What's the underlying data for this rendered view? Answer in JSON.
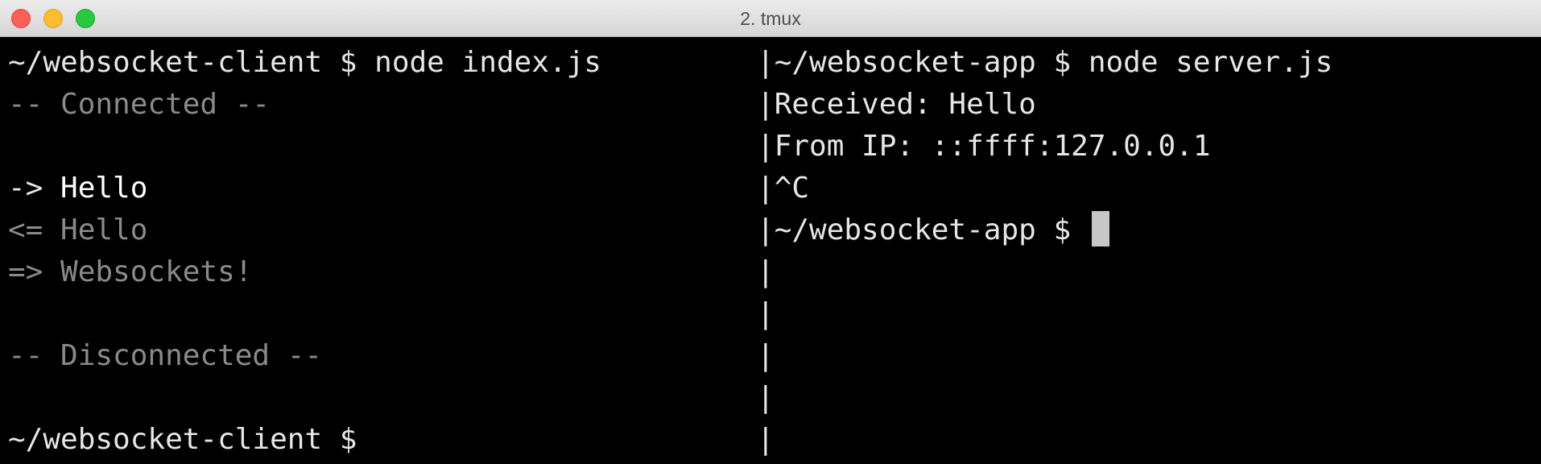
{
  "window": {
    "title": "2. tmux"
  },
  "left_pane": {
    "lines": [
      {
        "prefix": "~/websocket-client $ node index.js",
        "text": ""
      },
      {
        "prefix": "-- Connected --",
        "text": ""
      },
      {
        "prefix": "",
        "text": ""
      },
      {
        "prefix": "-> ",
        "text": "Hello"
      },
      {
        "prefix": "<= ",
        "text": "Hello"
      },
      {
        "prefix": "=> ",
        "text": "Websockets!"
      },
      {
        "prefix": "",
        "text": ""
      },
      {
        "prefix": "-- Disconnected --",
        "text": ""
      },
      {
        "prefix": "",
        "text": ""
      },
      {
        "prefix": "~/websocket-client $",
        "text": ""
      }
    ]
  },
  "right_pane": {
    "separator": "|",
    "lines": [
      "~/websocket-app $ node server.js",
      "Received: Hello",
      "From IP: ::ffff:127.0.0.1",
      "^C",
      "~/websocket-app $ ",
      "",
      "",
      "",
      "",
      ""
    ]
  }
}
